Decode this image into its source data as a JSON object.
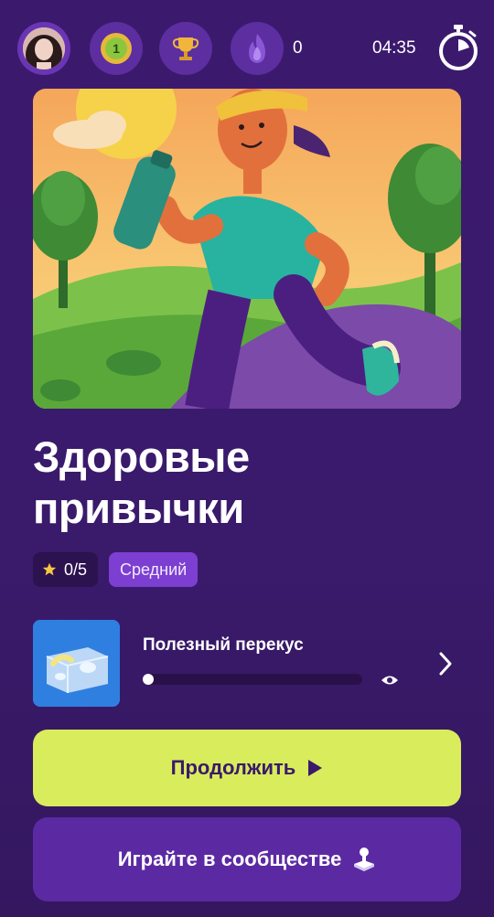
{
  "topbar": {
    "level_badge": "1",
    "flame_count": "0",
    "timer": "04:35",
    "icons": [
      "avatar",
      "level-medal-icon",
      "trophy-icon",
      "flame-icon",
      "stopwatch-icon"
    ]
  },
  "course": {
    "title_line1": "Здоровые",
    "title_line2": "привычки",
    "stars": "0/5",
    "difficulty": "Средний"
  },
  "lesson": {
    "title": "Полезный перекус",
    "progress_fraction": 0.05,
    "icons": [
      "eye-icon",
      "chevron-right-icon"
    ]
  },
  "buttons": {
    "continue_label": "Продолжить",
    "community_label": "Играйте в сообществе"
  },
  "colors": {
    "background": "#3a1a6b",
    "accent_lime": "#d9ec5c",
    "difficulty_badge": "#7c3fd1",
    "community_button": "#5b2aa3",
    "lesson_thumb": "#2f7fe0"
  }
}
